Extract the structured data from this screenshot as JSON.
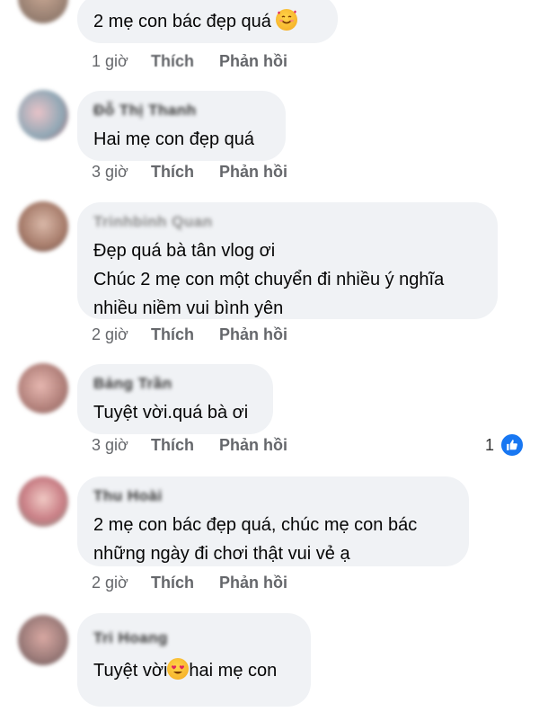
{
  "comments": [
    {
      "name": "",
      "lines": [
        "2 mẹ con bác đẹp quá"
      ],
      "emoji": "smiling-face-with-hearts",
      "time": "1 giờ",
      "like": "Thích",
      "reply": "Phản hồi"
    },
    {
      "name": "Đỗ Thị Thanh",
      "lines": [
        "Hai mẹ con đẹp quá"
      ],
      "time": "3 giờ",
      "like": "Thích",
      "reply": "Phản hồi"
    },
    {
      "name": "Trinhbinh Quan",
      "lines": [
        "Đẹp quá bà tân vlog ơi",
        "Chúc 2 mẹ con một chuyển đi nhiều ý nghĩa",
        "nhiều niềm vui  bình yên"
      ],
      "time": "2 giờ",
      "like": "Thích",
      "reply": "Phản hồi"
    },
    {
      "name": "Bảng Trần",
      "lines": [
        "Tuyệt vời.quá bà ơi"
      ],
      "time": "3 giờ",
      "like": "Thích",
      "reply": "Phản hồi",
      "reaction_count": "1"
    },
    {
      "name": "Thu Hoài",
      "lines": [
        "2 mẹ con bác đẹp quá, chúc mẹ con bác",
        "những ngày đi chơi thật vui vẻ ạ"
      ],
      "time": "2 giờ",
      "like": "Thích",
      "reply": "Phản hồi"
    },
    {
      "name": "Tri Hoang",
      "line_before_emoji": "Tuyệt vời",
      "line_after_emoji": "hai mẹ con",
      "emoji": "smiling-face-with-heart-eyes"
    }
  ],
  "colors": {
    "bubble": "#f0f2f5",
    "meta": "#65676b",
    "like_blue": "#1877f2"
  }
}
